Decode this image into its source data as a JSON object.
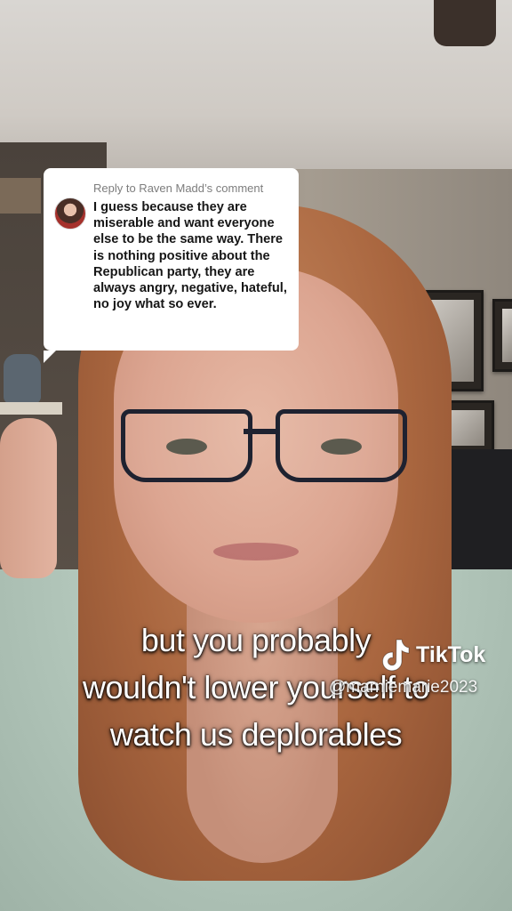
{
  "comment_reply": {
    "header": "Reply to Raven Madd’s comment",
    "text": "I guess because they are miserable and want everyone else to be the same way. There is nothing positive about the Republican party, they are always angry, negative, hateful, no joy what so ever."
  },
  "caption": {
    "lines": [
      "but you probably",
      "wouldn't lower yourself to",
      "watch us deplorables"
    ]
  },
  "watermark": {
    "brand": "TikTok",
    "username": "@marniemarie2023",
    "logo_icon": "tiktok-logo-icon"
  },
  "colors": {
    "bubble_bg": "#ffffff",
    "caption_text": "#ffffff",
    "header_text": "#7d7d7d"
  }
}
